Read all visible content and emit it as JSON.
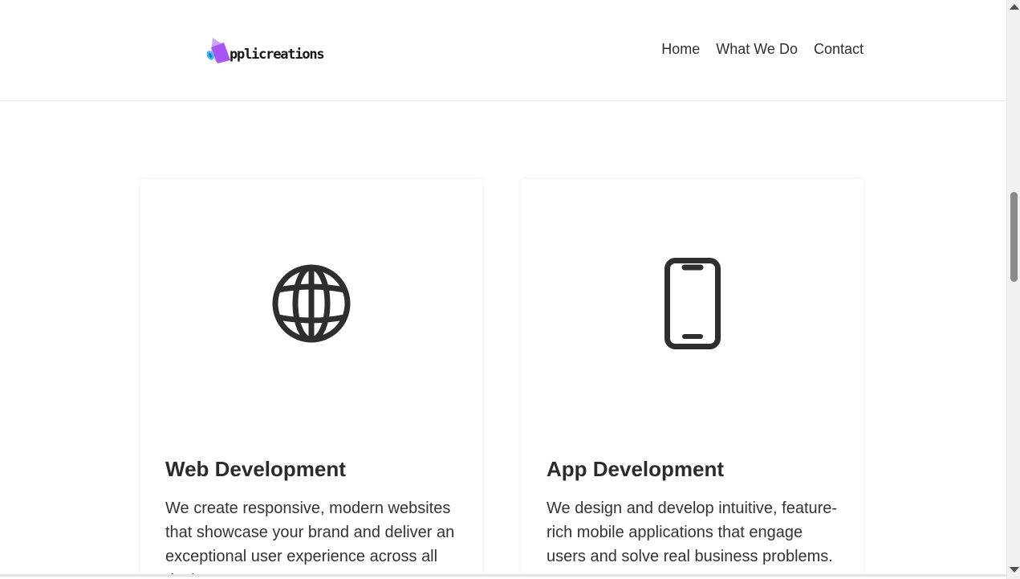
{
  "brand": {
    "logo_text": "pplicreations",
    "colors": {
      "primary_purple": "#a855f7",
      "light_purple": "#c7a6f5",
      "cyan": "#38bdf8"
    }
  },
  "nav": {
    "items": [
      {
        "label": "Home"
      },
      {
        "label": "What We Do"
      },
      {
        "label": "Contact"
      }
    ]
  },
  "services": [
    {
      "icon": "globe-icon",
      "title": "Web Development",
      "description": "We create responsive, modern websites that showcase your brand and deliver an exceptional user experience across all devices."
    },
    {
      "icon": "smartphone-icon",
      "title": "App Development",
      "description": "We design and develop intuitive, feature-rich mobile applications that engage users and solve real business problems."
    }
  ],
  "colors": {
    "text_dark": "#2d2d2d",
    "icon_stroke": "#2e2e2e"
  }
}
